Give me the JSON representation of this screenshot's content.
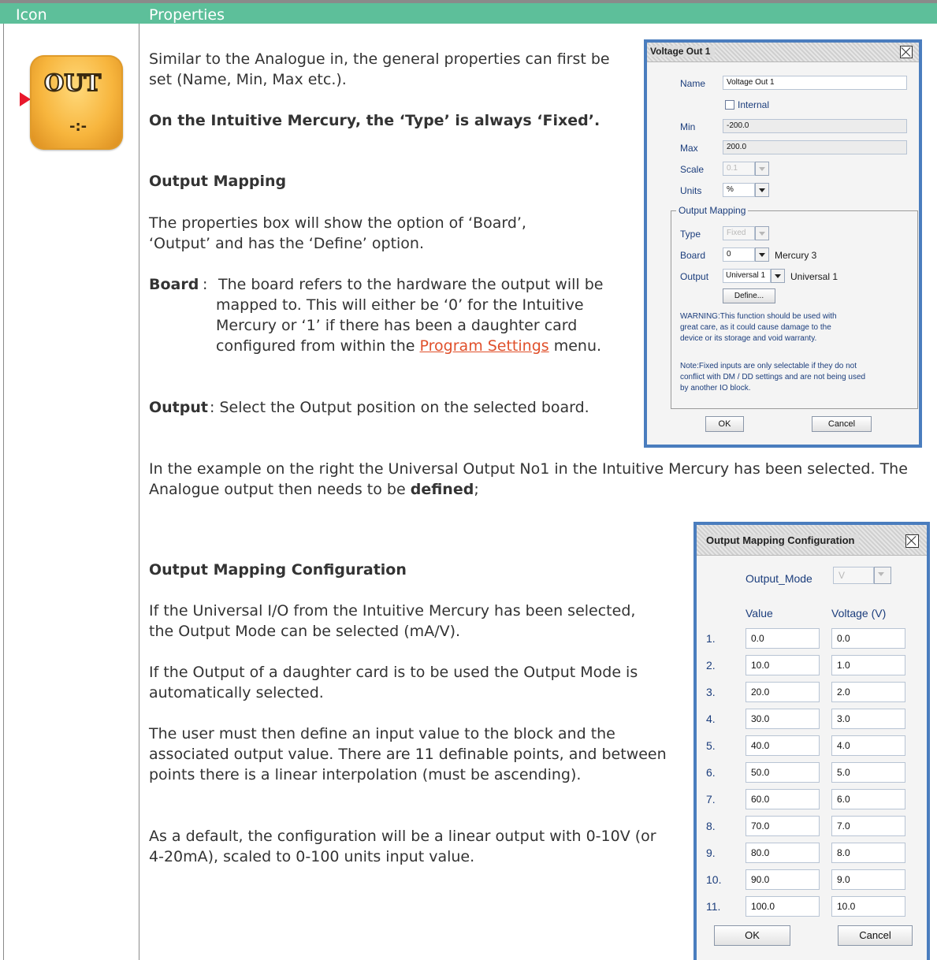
{
  "table": {
    "header_icon": "Icon",
    "header_properties": "Properties"
  },
  "icon_block": {
    "icon": "analogue-out-icon",
    "label": "OUT",
    "sub": "-:-"
  },
  "text": {
    "p1": "Similar to the Analogue in, the general properties can first be set (Name, Min, Max etc.).",
    "p2_bold": "On the Intuitive Mercury, the ‘Type’ is always ‘Fixed’.",
    "h_output_mapping": "Output Mapping",
    "p3": "The properties box will show the option of ‘Board’, ‘Output’ and has the ‘Define’ option.",
    "board_term": "Board",
    "board_colon": ":",
    "board_text_a": "The board refers to the hardware the output will be mapped to. This will either be ‘0’ for the Intuitive Mercury or ‘1’ if there has been a daughter card configured from within the",
    "board_link": "Program Settings",
    "board_text_b": "menu.",
    "output_term": "Output",
    "output_text": ": Select the Output position on the selected board.",
    "p4_a": "In the example on the right the Universal Output No1 in the Intuitive Mercury has been selected. The Analogue output then needs to be",
    "p4_bold": "defined",
    "p4_end": ";",
    "h_output_mapping_config": "Output Mapping Configuration",
    "p5": "If the Universal I/O from the Intuitive Mercury has been selected, the Output Mode can be selected (mA/V).",
    "p6": "If the Output of a daughter card is to be used the Output Mode is automatically selected.",
    "p7": "The user must then define an input value to the block and the associated output value. There are 11 definable points, and between points there is a linear interpolation (must be ascending).",
    "p8": "As a default, the configuration will be a linear output with 0-10V (or 4-20mA), scaled to 0-100 units input value."
  },
  "voltage_dialog": {
    "title": "Voltage Out 1",
    "name_label": "Name",
    "name_value": "Voltage Out 1",
    "internal_label": "Internal",
    "min_label": "Min",
    "min_value": "-200.0",
    "max_label": "Max",
    "max_value": "200.0",
    "scale_label": "Scale",
    "scale_value": "0.1",
    "units_label": "Units",
    "units_value": "%",
    "group_label": "Output Mapping",
    "type_label": "Type",
    "type_value": "Fixed",
    "board_label": "Board",
    "board_value": "0",
    "board_desc": "Mercury 3",
    "output_label": "Output",
    "output_value": "Universal 1",
    "output_desc": "Universal 1",
    "define_button": "Define...",
    "warning_line1": "WARNING:This function should be used with",
    "warning_line2": "great care, as it could cause damage to the",
    "warning_line3": "device or its storage and void warranty.",
    "note_line1": "Note:Fixed inputs are only selectable if they do not",
    "note_line2": "conflict with DM / DD settings and are not being used",
    "note_line3": "by another IO block.",
    "ok_button": "OK",
    "cancel_button": "Cancel"
  },
  "mapping_dialog": {
    "title": "Output Mapping Configuration",
    "mode_label": "Output_Mode",
    "mode_value": "V",
    "col_value": "Value",
    "col_voltage": "Voltage (V)",
    "rows": [
      {
        "n": "1.",
        "value": "0.0",
        "voltage": "0.0"
      },
      {
        "n": "2.",
        "value": "10.0",
        "voltage": "1.0"
      },
      {
        "n": "3.",
        "value": "20.0",
        "voltage": "2.0"
      },
      {
        "n": "4.",
        "value": "30.0",
        "voltage": "3.0"
      },
      {
        "n": "5.",
        "value": "40.0",
        "voltage": "4.0"
      },
      {
        "n": "6.",
        "value": "50.0",
        "voltage": "5.0"
      },
      {
        "n": "7.",
        "value": "60.0",
        "voltage": "6.0"
      },
      {
        "n": "8.",
        "value": "70.0",
        "voltage": "7.0"
      },
      {
        "n": "9.",
        "value": "80.0",
        "voltage": "8.0"
      },
      {
        "n": "10.",
        "value": "90.0",
        "voltage": "9.0"
      },
      {
        "n": "11.",
        "value": "100.0",
        "voltage": "10.0"
      }
    ],
    "ok_button": "OK",
    "cancel_button": "Cancel"
  },
  "colors": {
    "header": "#5dbf9a",
    "dialog_border": "#4a7dbe",
    "link": "#e0502b",
    "label_blue": "#1b3d7c"
  }
}
